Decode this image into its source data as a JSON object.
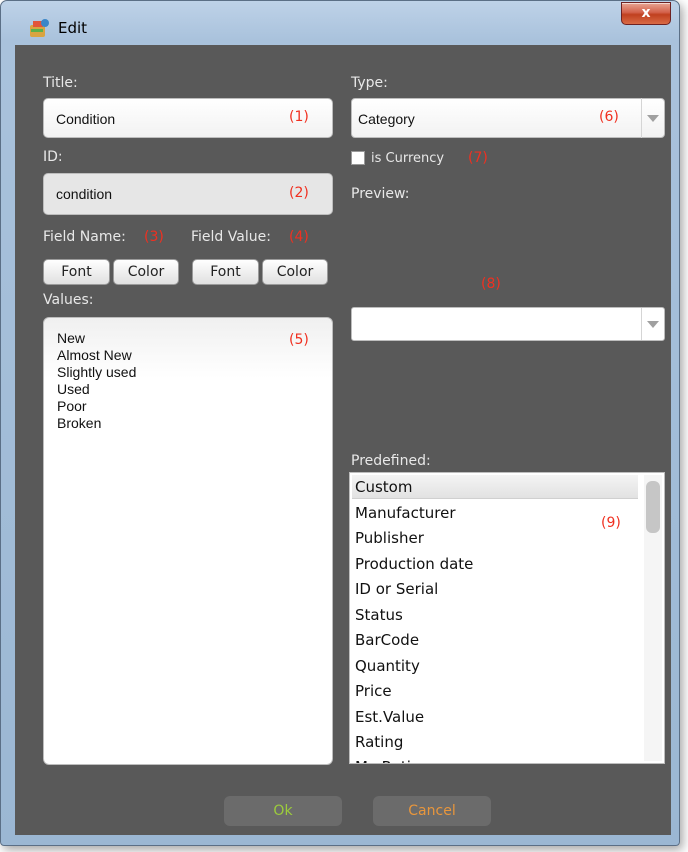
{
  "window": {
    "title": "Edit",
    "close_glyph": "x"
  },
  "form": {
    "title_label": "Title:",
    "title_value": "Condition",
    "id_label": "ID:",
    "id_value": "condition",
    "field_name_label": "Field Name:",
    "field_value_label": "Field Value:",
    "font_label": "Font",
    "color_label": "Color",
    "values_label": "Values:",
    "values": [
      "New",
      "Almost New",
      "Slightly used",
      "Used",
      "Poor",
      "Broken"
    ],
    "type_label": "Type:",
    "type_value": "Category",
    "is_currency_label": "is Currency",
    "preview_label": "Preview:",
    "predefined_label": "Predefined:",
    "predefined_items": [
      "Custom",
      "Manufacturer",
      "Publisher",
      "Production date",
      "ID or Serial",
      "Status",
      "BarCode",
      "Quantity",
      "Price",
      "Est.Value",
      "Rating",
      "My Rating"
    ],
    "selected_predefined": "Custom"
  },
  "annotations": [
    "(1)",
    "(2)",
    "(3)",
    "(4)",
    "(5)",
    "(6)",
    "(7)",
    "(8)",
    "(9)"
  ],
  "buttons": {
    "ok": "Ok",
    "cancel": "Cancel"
  },
  "colors": {
    "panel_bg": "#595959",
    "annotation": "#f03020",
    "ok_text": "#9ccc3c",
    "cancel_text": "#e8963c"
  }
}
